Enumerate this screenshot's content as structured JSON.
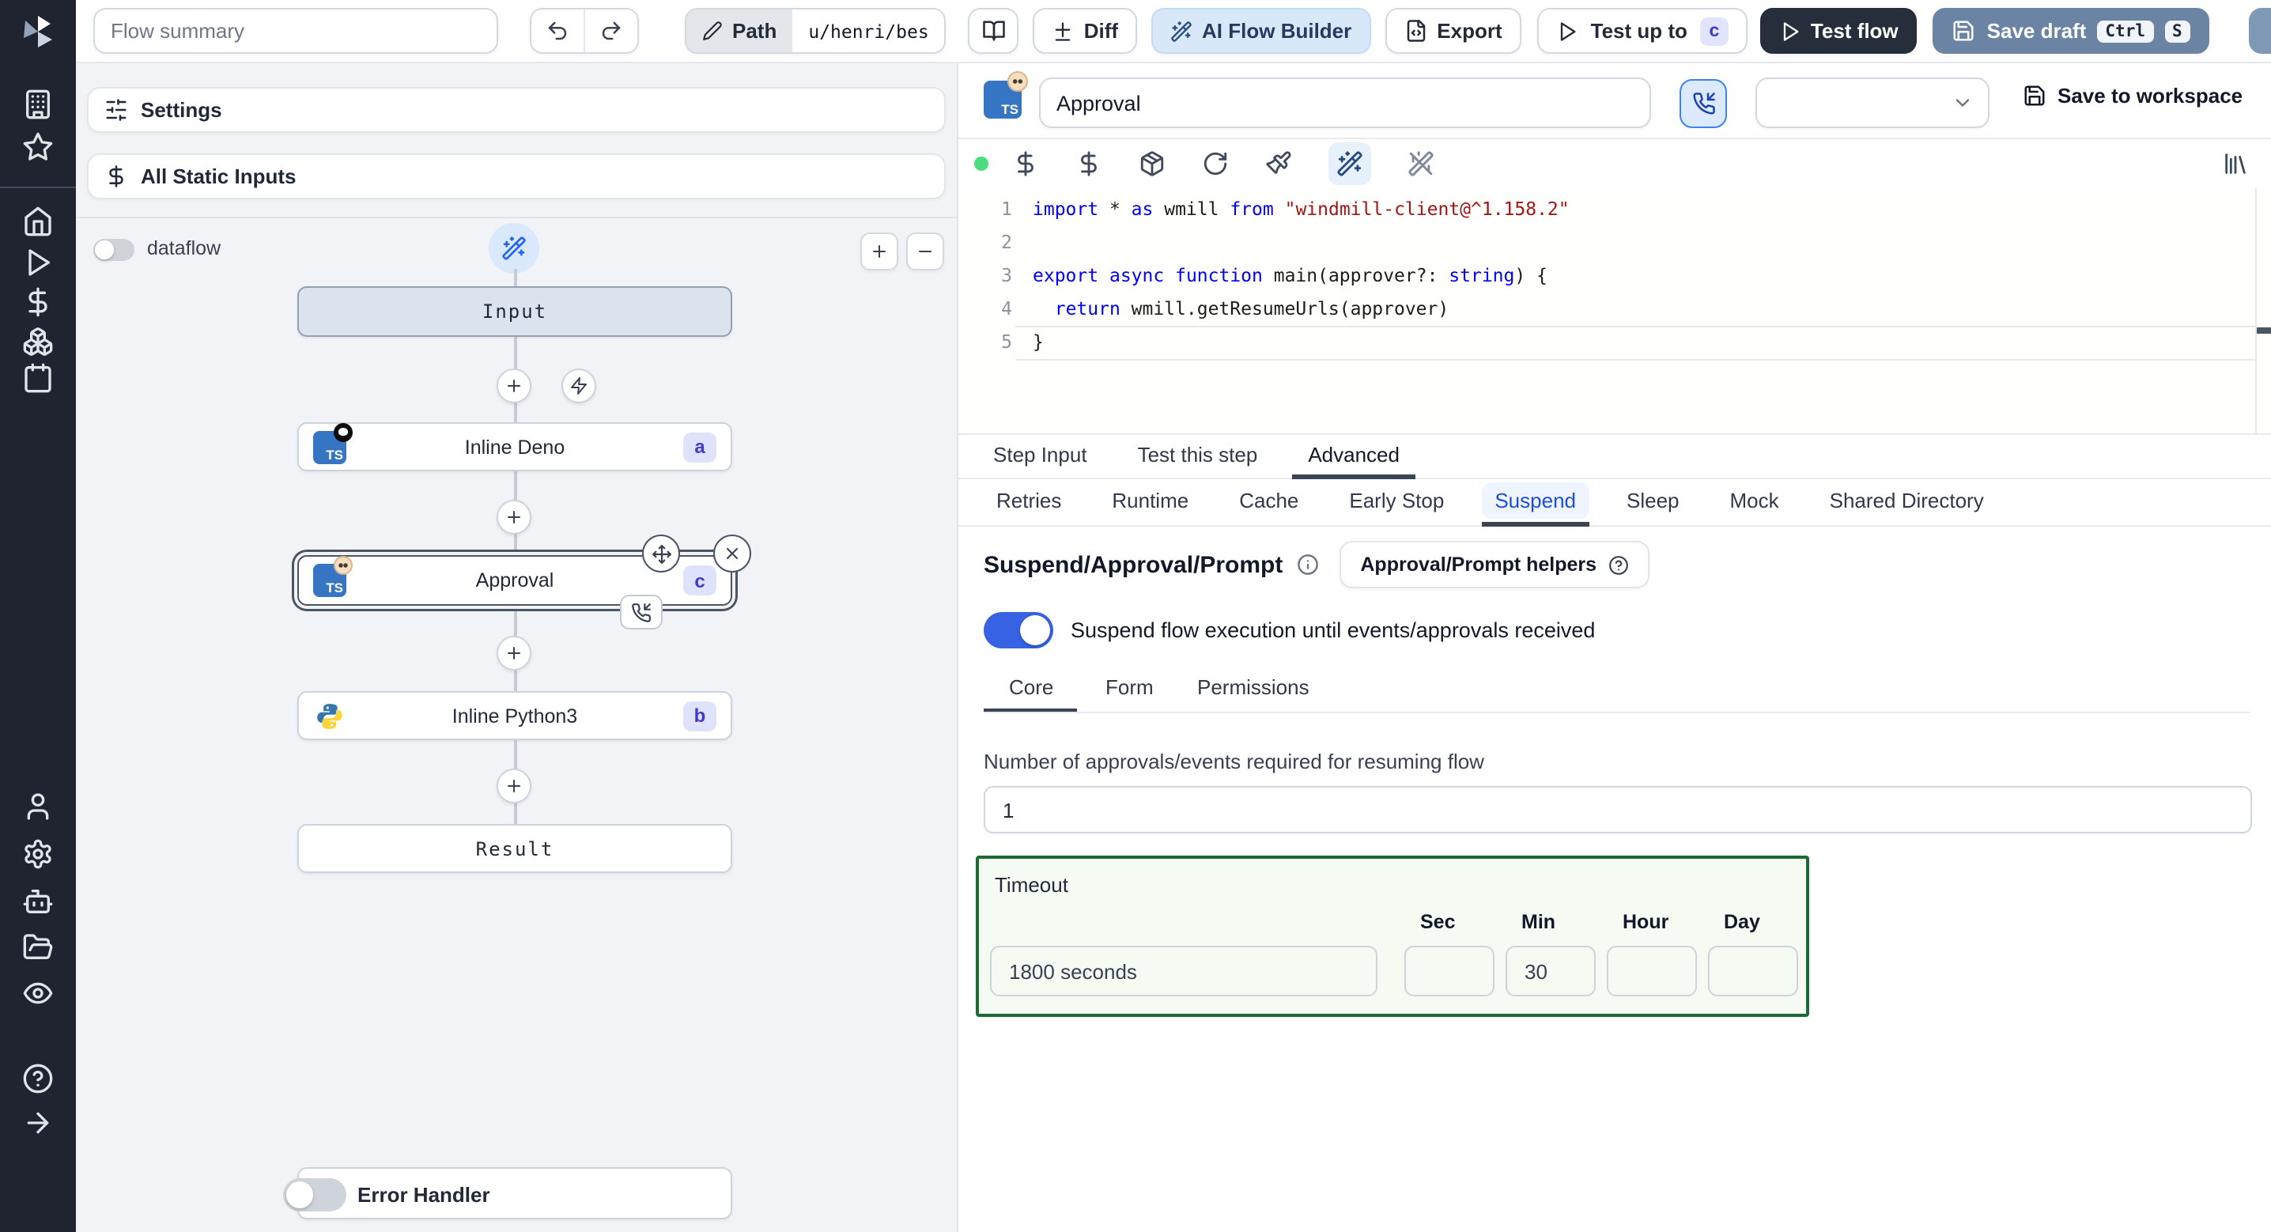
{
  "topbar": {
    "flow_summary_placeholder": "Flow summary",
    "path_label": "Path",
    "path_value": "u/henri/bes",
    "diff_label": "Diff",
    "ai_flow_builder_label": "AI Flow Builder",
    "export_label": "Export",
    "test_up_to_label": "Test up to",
    "test_up_to_badge": "c",
    "test_flow_label": "Test flow",
    "save_draft_label": "Save draft",
    "save_draft_shortcut": [
      "Ctrl",
      "S"
    ]
  },
  "rail": {
    "icons": [
      "building",
      "star",
      "home",
      "play",
      "dollar",
      "boxes",
      "calendar",
      "user",
      "settings",
      "bot",
      "folder-open",
      "eye",
      "help-circle",
      "arrow-right"
    ]
  },
  "left_panel": {
    "settings_label": "Settings",
    "all_static_inputs_label": "All Static Inputs",
    "dataflow_label": "dataflow",
    "graph": {
      "input_label": "Input",
      "steps": [
        {
          "label": "Inline Deno",
          "badge": "a",
          "icon": "typescript-deno"
        },
        {
          "label": "Approval",
          "badge": "c",
          "icon": "typescript-approval",
          "selected": true
        },
        {
          "label": "Inline Python3",
          "badge": "b",
          "icon": "python"
        }
      ],
      "result_label": "Result"
    },
    "error_handler_label": "Error Handler"
  },
  "step": {
    "name_value": "Approval",
    "save_to_workspace_label": "Save to workspace",
    "toolbar_icons": [
      "status-dot",
      "dollar",
      "dollar",
      "package",
      "refresh",
      "paintbrush",
      "wand",
      "wand-off",
      "library"
    ]
  },
  "editor": {
    "lines": [
      {
        "n": "1",
        "tokens": [
          [
            "import",
            "kw"
          ],
          [
            " * ",
            "pl"
          ],
          [
            "as",
            "kw"
          ],
          [
            " wmill ",
            "pl"
          ],
          [
            "from",
            "kw"
          ],
          [
            " ",
            "pl"
          ],
          [
            "\"windmill-client@^1.158.2\"",
            "str"
          ]
        ]
      },
      {
        "n": "2",
        "tokens": []
      },
      {
        "n": "3",
        "tokens": [
          [
            "export",
            "kw"
          ],
          [
            " ",
            "pl"
          ],
          [
            "async",
            "kw"
          ],
          [
            " ",
            "pl"
          ],
          [
            "function",
            "kw"
          ],
          [
            " main(approver?: ",
            "pl"
          ],
          [
            "string",
            "kw"
          ],
          [
            ") {",
            "pl"
          ]
        ]
      },
      {
        "n": "4",
        "tokens": [
          [
            "  ",
            "pl"
          ],
          [
            "return",
            "kw"
          ],
          [
            " wmill.getResumeUrls(approver)",
            "pl"
          ]
        ]
      },
      {
        "n": "5",
        "tokens": [
          [
            "}",
            "pl"
          ]
        ]
      }
    ]
  },
  "tabs": {
    "main": [
      "Step Input",
      "Test this step",
      "Advanced"
    ],
    "main_active": "Advanced",
    "advanced": [
      "Retries",
      "Runtime",
      "Cache",
      "Early Stop",
      "Suspend",
      "Sleep",
      "Mock",
      "Shared Directory"
    ],
    "advanced_active": "Suspend"
  },
  "suspend": {
    "title": "Suspend/Approval/Prompt",
    "helpers_button_label": "Approval/Prompt helpers",
    "toggle_label": "Suspend flow execution until events/approvals received",
    "toggle_on": true,
    "tabs": [
      "Core",
      "Form",
      "Permissions"
    ],
    "tabs_active": "Core",
    "approvals_label": "Number of approvals/events required for resuming flow",
    "approvals_value": "1",
    "timeout": {
      "label": "Timeout",
      "display_value": "1800 seconds",
      "units": [
        "Sec",
        "Min",
        "Hour",
        "Day"
      ],
      "sec_value": "",
      "min_value": "30",
      "hour_value": "",
      "day_value": ""
    }
  },
  "colors": {
    "accent_toggle_blue": "#3662e3",
    "ai_button_bg": "#d8e8f8",
    "test_flow_bg": "#262d3b",
    "save_draft_bg": "#6b84a3",
    "timeout_border_green": "#1c6b34",
    "code_keyword": "#0000ff",
    "code_string": "#a31515",
    "status_dot_green": "#4ade80",
    "badge_bg": "#dee2fb",
    "badge_text": "#4338ca"
  }
}
